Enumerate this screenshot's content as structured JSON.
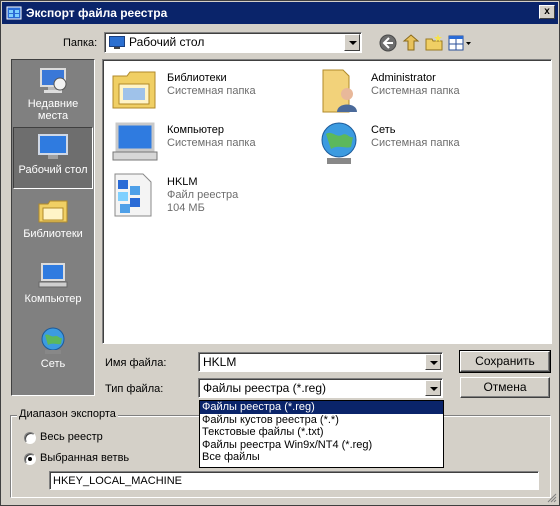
{
  "window": {
    "title": "Экспорт файла реестра",
    "close_glyph": "x"
  },
  "folder_bar": {
    "label": "Папка:",
    "selected": "Рабочий стол",
    "folder_icon": "desktop-icon"
  },
  "toolbar_icons": [
    "back-icon",
    "up-folder-icon",
    "new-folder-icon",
    "view-menu-icon"
  ],
  "places": [
    {
      "label": "Недавние места",
      "icon": "recent-places-icon",
      "selected": false
    },
    {
      "label": "Рабочий стол",
      "icon": "desktop-icon",
      "selected": true
    },
    {
      "label": "Библиотеки",
      "icon": "libraries-icon",
      "selected": false
    },
    {
      "label": "Компьютер",
      "icon": "computer-icon",
      "selected": false
    },
    {
      "label": "Сеть",
      "icon": "network-icon",
      "selected": false
    }
  ],
  "files": [
    {
      "name": "Библиотеки",
      "type": "Системная папка",
      "icon": "libraries-folder-icon"
    },
    {
      "name": "Administrator",
      "type": "Системная папка",
      "icon": "user-folder-icon"
    },
    {
      "name": "Компьютер",
      "type": "Системная папка",
      "icon": "computer-icon"
    },
    {
      "name": "Сеть",
      "type": "Системная папка",
      "icon": "network-globe-icon"
    },
    {
      "name": "HKLM",
      "type": "Файл реестра",
      "size": "104 МБ",
      "icon": "registry-file-icon"
    }
  ],
  "filename": {
    "label": "Имя файла:",
    "value": "HKLM"
  },
  "filetype": {
    "label": "Тип файла:",
    "value": "Файлы реестра (*.reg)",
    "options": [
      "Файлы реестра (*.reg)",
      "Файлы кустов реестра (*.*)",
      "Текстовые файлы (*.txt)",
      "Файлы реестра Win9x/NT4 (*.reg)",
      "Все файлы"
    ],
    "selected_index": 0
  },
  "buttons": {
    "save": "Сохранить",
    "cancel": "Отмена"
  },
  "export_range": {
    "title": "Диапазон экспорта",
    "all_label": "Весь реестр",
    "branch_label": "Выбранная ветвь",
    "selected": "branch",
    "branch_value": "HKEY_LOCAL_MACHINE"
  },
  "colors": {
    "titlebar": "#0a246a",
    "dialog_bg": "#d4d0c8",
    "places_bg": "#808080",
    "selection": "#0a246a"
  }
}
